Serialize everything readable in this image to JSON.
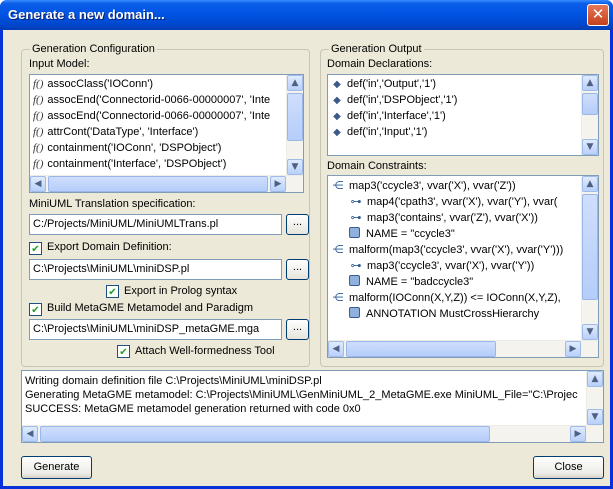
{
  "window": {
    "title": "Generate a new domain...",
    "close_glyph": "✕"
  },
  "config": {
    "legend": "Generation Configuration",
    "input_model_label": "Input Model:",
    "input_model_rows": [
      "assocClass('IOConn')",
      "assocEnd('Connectorid-0066-00000007', 'Inte",
      "assocEnd('Connectorid-0066-00000007', 'Inte",
      "attrCont('DataType', 'Interface')",
      "containment('IOConn', 'DSPObject')",
      "containment('Interface', 'DSPObject')"
    ],
    "input_model_icon_text": "f()",
    "trans_label": "MiniUML Translation specification:",
    "trans_value": "C:/Projects/MiniUML/MiniUMLTrans.pl",
    "export_label": "Export Domain Definition:",
    "export_checked": true,
    "export_value": "C:\\Projects\\MiniUML\\miniDSP.pl",
    "prolog_label": "Export in Prolog syntax",
    "prolog_checked": true,
    "build_label": "Build MetaGME Metamodel and Paradigm",
    "build_checked": true,
    "build_value": "C:\\Projects\\MiniUML\\miniDSP_metaGME.mga",
    "attach_label": "Attach Well-formedness Tool",
    "attach_checked": true,
    "browse_label": "..."
  },
  "output": {
    "legend": "Generation Output",
    "declarations_label": "Domain Declarations:",
    "declarations": [
      "def('in','Output','1')",
      "def('in','DSPObject','1')",
      "def('in','Interface','1')",
      "def('in','Input','1')"
    ],
    "constraints_label": "Domain Constraints:",
    "constraints": [
      {
        "icon": "map",
        "indent": 0,
        "text": "map3('ccycle3', vvar('X'), vvar('Z'))"
      },
      {
        "icon": "link",
        "indent": 1,
        "text": "map4('cpath3', vvar('X'), vvar('Y'), vvar("
      },
      {
        "icon": "link",
        "indent": 1,
        "text": "map3('contains', vvar('Z'), vvar('X'))"
      },
      {
        "icon": "box",
        "indent": 1,
        "text": "NAME = \"ccycle3\""
      },
      {
        "icon": "map",
        "indent": 0,
        "text": "malform(map3('ccycle3', vvar('X'), vvar('Y')))"
      },
      {
        "icon": "link",
        "indent": 1,
        "text": "map3('ccycle3', vvar('X'), vvar('Y'))"
      },
      {
        "icon": "box",
        "indent": 1,
        "text": "NAME = \"badccycle3\""
      },
      {
        "icon": "map",
        "indent": 0,
        "text": "malform(IOConn(X,Y,Z)) <= IOConn(X,Y,Z),"
      },
      {
        "icon": "box",
        "indent": 1,
        "text": "ANNOTATION MustCrossHierarchy"
      }
    ]
  },
  "log": {
    "lines": [
      "Writing domain definition file C:\\Projects\\MiniUML\\miniDSP.pl",
      "Generating MetaGME metamodel: C:\\Projects\\MiniUML\\GenMiniUML_2_MetaGME.exe MiniUML_File=\"C:\\Projec",
      "SUCCESS: MetaGME metamodel generation returned with code 0x0"
    ]
  },
  "buttons": {
    "generate": "Generate",
    "close": "Close"
  },
  "scroll_glyphs": {
    "up": "▲",
    "down": "▼",
    "left": "◀",
    "right": "▶"
  }
}
